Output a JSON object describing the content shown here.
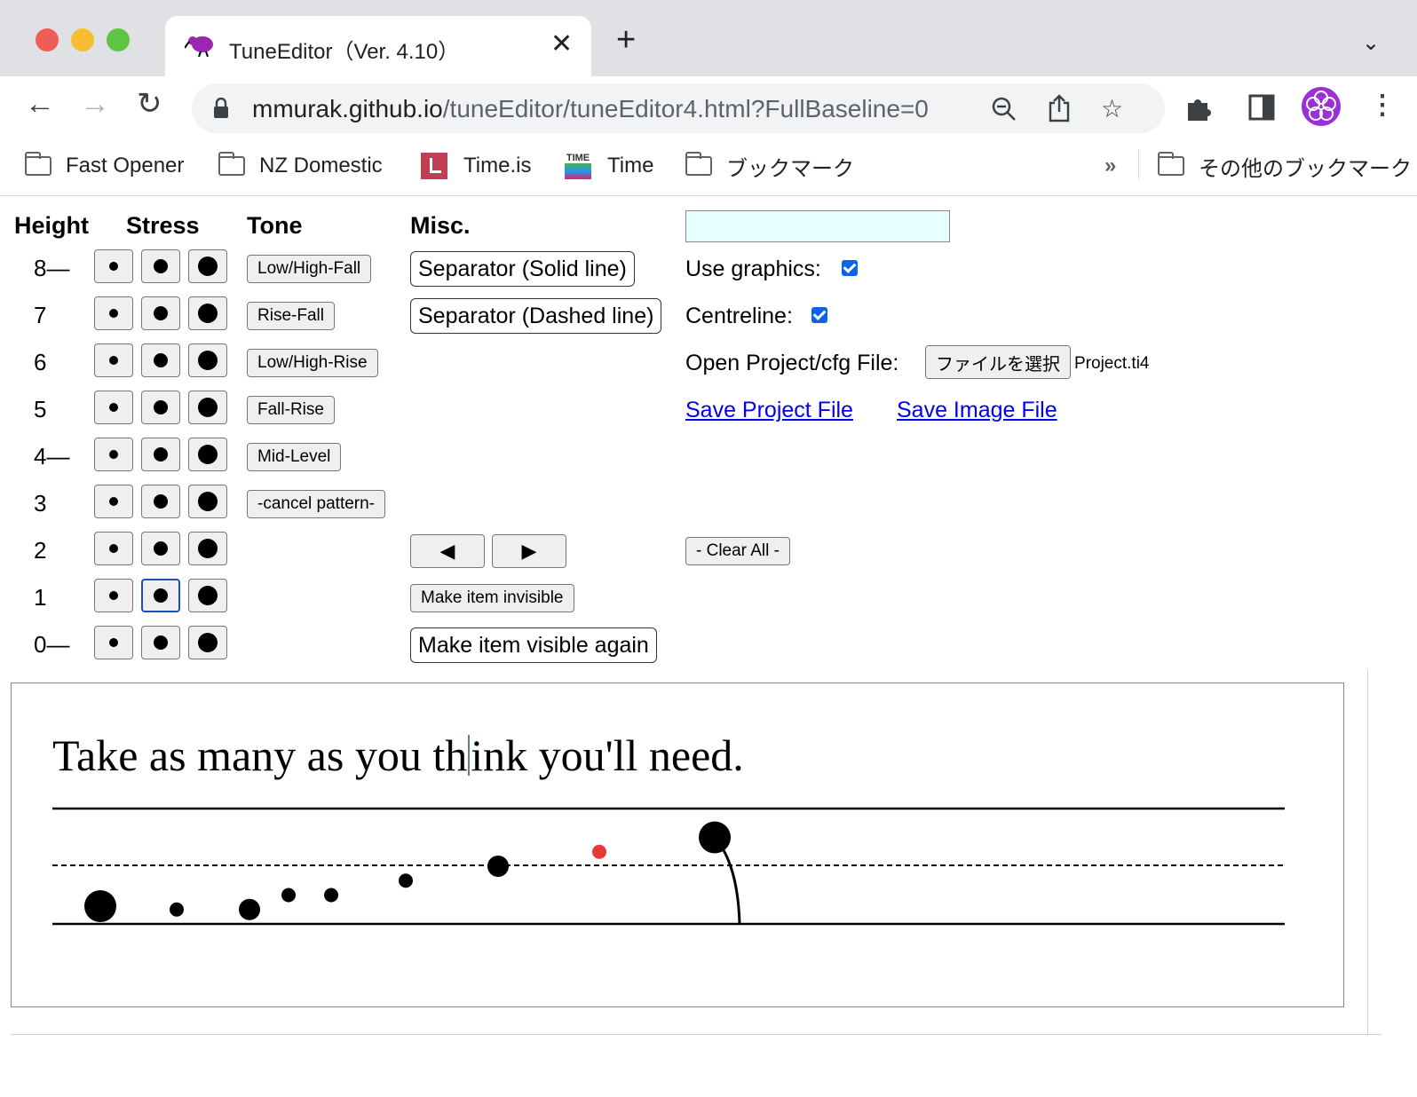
{
  "browser": {
    "tab_title": "TuneEditor（Ver. 4.10）",
    "url_host": "mmurak.github.io",
    "url_path": "/tuneEditor/tuneEditor4.html?FullBaseline=0",
    "bookmarks": [
      "Fast Opener",
      "NZ Domestic",
      "Time.is",
      "Time",
      "ブックマーク"
    ],
    "more_bookmarks_chevron": "»",
    "other_bookmarks": "その他のブックマーク"
  },
  "headers": {
    "height": "Height",
    "stress": "Stress",
    "tone": "Tone",
    "misc": "Misc."
  },
  "rows": [
    "8—",
    "7",
    "6",
    "5",
    "4—",
    "3",
    "2",
    "1",
    "0—"
  ],
  "tone_buttons": [
    "Low/High-Fall",
    "Rise-Fall",
    "Low/High-Rise",
    "Fall-Rise",
    "Mid-Level",
    "-cancel pattern-"
  ],
  "misc": {
    "sep_solid": "Separator (Solid line)",
    "sep_dashed": "Separator (Dashed line)",
    "prev_arrow": "◀",
    "next_arrow": "▶",
    "make_invisible": "Make item invisible",
    "make_visible": "Make item visible again"
  },
  "options": {
    "text_input_value": "",
    "use_graphics_label": "Use graphics:",
    "use_graphics_checked": true,
    "centreline_label": "Centreline:",
    "centreline_checked": true,
    "open_file_label": "Open Project/cfg File:",
    "choose_file_button": "ファイルを選択",
    "chosen_file": "Project.ti4",
    "save_project": "Save Project File",
    "save_image": "Save Image File",
    "clear_all": "- Clear All -"
  },
  "canvas": {
    "sentence_before": "Take as many as you th",
    "sentence_after": "ink you'll need.",
    "cursor_color": "#5a8a5a",
    "dot_color": "#000000",
    "highlight_dot_color": "#e53935",
    "dots": [
      {
        "height": 0,
        "stress": 3
      },
      {
        "height": 1,
        "stress": 1
      },
      {
        "height": 1,
        "stress": 2
      },
      {
        "height": 2,
        "stress": 1
      },
      {
        "height": 2,
        "stress": 1
      },
      {
        "height": 3,
        "stress": 1
      },
      {
        "height": 4,
        "stress": 2
      },
      {
        "height": 5,
        "stress": 1,
        "highlight": true
      },
      {
        "height": 6,
        "stress": 3,
        "tone": "fall-to-baseline"
      }
    ]
  }
}
